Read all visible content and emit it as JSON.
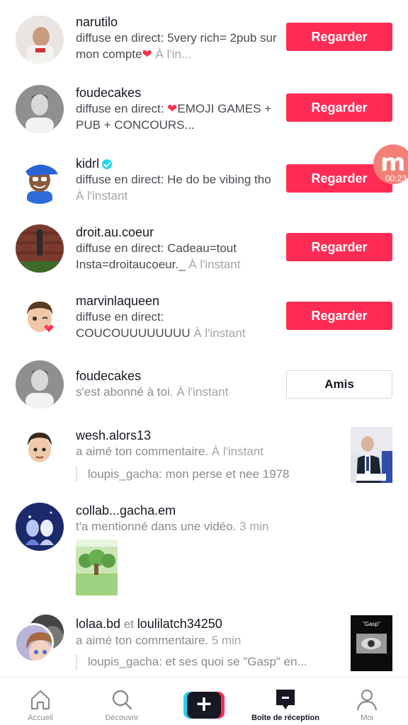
{
  "notifications": [
    {
      "username": "narutilo",
      "desc_prefix": "diffuse en direct: 5very rich= 2pub sur mon compte",
      "desc_suffix": " À l'in...",
      "action": "Regarder"
    },
    {
      "username": "foudecakes",
      "desc_prefix": "diffuse en direct: ",
      "desc_suffix": "EMOJI GAMES + PUB + CONCOURS...",
      "action": "Regarder"
    },
    {
      "username": "kidrl",
      "desc": "diffuse en direct: He do be vibing tho ",
      "time": "À l'instant",
      "action": "Regarder"
    },
    {
      "username": "droit.au.coeur",
      "desc": "diffuse en direct: Cadeau=tout Insta=droitaucoeur._ ",
      "time": "À l'instant",
      "action": "Regarder"
    },
    {
      "username": "marvinlaqueen",
      "desc": "diffuse en direct: COUCOUUUUUUUU ",
      "time": "À l'instant",
      "action": "Regarder"
    },
    {
      "username": "foudecakes",
      "desc": "s'est abonné à toi. ",
      "time": "À l'instant",
      "action": "Amis"
    },
    {
      "username": "wesh.alors13",
      "desc": "a aimé ton commentaire. ",
      "time": "À l'instant",
      "quote": "loupis_gacha: mon perse et nee 1978"
    },
    {
      "username": "collab...gacha.em",
      "desc": "t'a mentionné dans une vidéo. ",
      "time": "3 min"
    },
    {
      "username": "lolaa.bd",
      "joiner": " et ",
      "username2": "loulilatch34250",
      "desc": "a aimé ton commentaire. ",
      "time": "5 min",
      "quote": "loupis_gacha: et ses quoi se \"Gasp\" en..."
    }
  ],
  "floating_badge": {
    "letter": "m",
    "time": "00:23"
  },
  "thumb_caption": "\"Gasp\"",
  "tabbar": {
    "home": "Accueil",
    "discover": "Découvrir",
    "inbox": "Boîte de réception",
    "me": "Moi"
  },
  "colors": {
    "accent": "#fe2c55",
    "cyan": "#20d5ec",
    "text": "#161823"
  }
}
